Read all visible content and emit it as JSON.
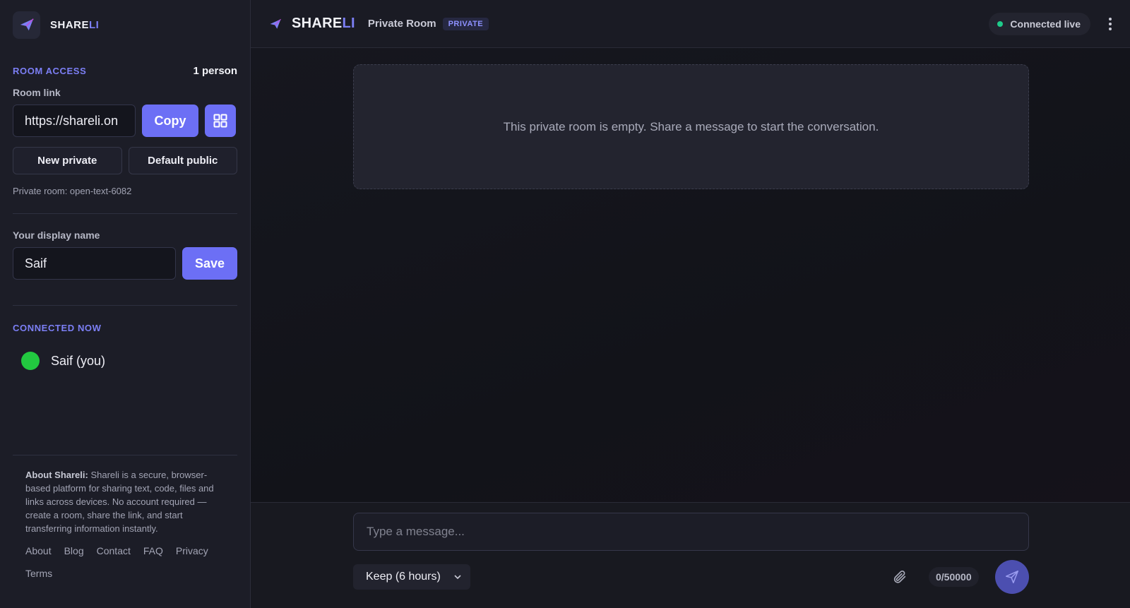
{
  "brand": {
    "name_main": "SHARE",
    "name_accent": "LI"
  },
  "sidebar": {
    "room_access": {
      "title": "ROOM ACCESS",
      "count": "1 person",
      "room_link_label": "Room link",
      "room_link_value": "https://shareli.on",
      "copy_label": "Copy",
      "new_private_label": "New private",
      "default_public_label": "Default public",
      "private_room_text": "Private room: open-text-6082"
    },
    "display_name": {
      "label": "Your display name",
      "value": "Saif",
      "save_label": "Save"
    },
    "connected": {
      "title": "CONNECTED NOW",
      "users": [
        {
          "name": "Saif (you)"
        }
      ]
    },
    "about": {
      "lead": "About Shareli:",
      "text": " Shareli is a secure, browser-based platform for sharing text, code, files and links across devices. No account required — create a room, share the link, and start transferring information instantly."
    },
    "footer_links": [
      "About",
      "Blog",
      "Contact",
      "FAQ",
      "Privacy",
      "Terms"
    ]
  },
  "header": {
    "title_main": "SHARE",
    "title_accent": "LI",
    "room_name": "Private Room",
    "badge": "PRIVATE",
    "status": "Connected live"
  },
  "main": {
    "empty_message": "This private room is empty. Share a message to start the conversation."
  },
  "composer": {
    "placeholder": "Type a message...",
    "keep_option": "Keep (6 hours)",
    "counter": "0/50000"
  },
  "colors": {
    "accent": "#6c6ff5",
    "online": "#22c840",
    "live": "#1ecb8a"
  }
}
